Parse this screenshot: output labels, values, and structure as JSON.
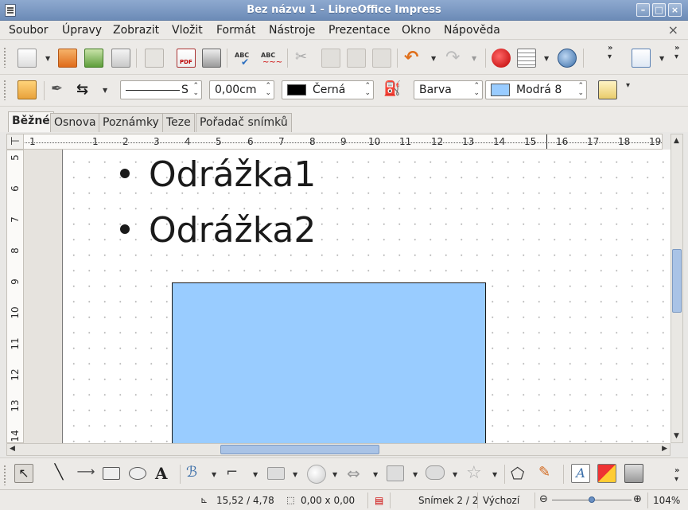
{
  "window": {
    "title": "Bez názvu 1 - LibreOffice Impress"
  },
  "menu": [
    "Soubor",
    "Úpravy",
    "Zobrazit",
    "Vložit",
    "Formát",
    "Nástroje",
    "Prezentace",
    "Okno",
    "Nápověda"
  ],
  "menu_close": "×",
  "line_toolbar": {
    "line_style_value": "S",
    "line_width_value": "0,00cm",
    "line_color": {
      "label": "Černá",
      "hex": "#000000"
    },
    "area_style_value": "Barva",
    "area_color": {
      "label": "Modrá 8",
      "hex": "#99ccff"
    }
  },
  "view_tabs": [
    "Běžné",
    "Osnova",
    "Poznámky",
    "Teze",
    "Pořadač snímků"
  ],
  "active_tab": "Běžné",
  "ruler": {
    "corner": "⊢",
    "horizontal": [
      "1",
      "1",
      "2",
      "3",
      "4",
      "5",
      "6",
      "7",
      "8",
      "9",
      "10",
      "11",
      "12",
      "13",
      "14",
      "15",
      "16",
      "17",
      "18",
      "19"
    ],
    "vertical": [
      "5",
      "6",
      "7",
      "8",
      "9",
      "10",
      "11",
      "12",
      "13",
      "14"
    ]
  },
  "slide": {
    "bullets": [
      "Odrážka1",
      "Odrážka2"
    ],
    "shape_fill": "#99ccff"
  },
  "status": {
    "position": "15,52 / 4,78",
    "size": "0,00 x 0,00",
    "slide_number": "Snímek 2 / 2",
    "layout": "Výchozí",
    "zoom": "104%"
  },
  "icons": {
    "toolbar1": [
      "new-document-icon",
      "open-folder-icon",
      "save-icon",
      "email-icon",
      "edit-file-icon",
      "export-pdf-icon",
      "print-icon",
      "spellcheck-icon",
      "autospellcheck-icon",
      "cut-icon",
      "copy-icon",
      "paste-icon",
      "clone-formatting-icon",
      "undo-icon",
      "redo-icon",
      "chart-icon",
      "table-icon",
      "hyperlink-icon",
      "insert-slide-icon"
    ],
    "toolbar2": [
      "styles-icon",
      "line-icon",
      "arrow-style-icon",
      "area-icon",
      "shadow-icon"
    ],
    "drawing": [
      "select-icon",
      "line-tool-icon",
      "arrow-line-icon",
      "rectangle-icon",
      "ellipse-icon",
      "text-icon",
      "curve-icon",
      "connector-icon",
      "basic-shapes-icon",
      "symbol-shapes-icon",
      "block-arrows-icon",
      "flowchart-icon",
      "callouts-icon",
      "stars-icon",
      "points-icon",
      "glue-points-icon",
      "fontwork-icon",
      "insert-image-icon",
      "extrusion-icon"
    ]
  }
}
